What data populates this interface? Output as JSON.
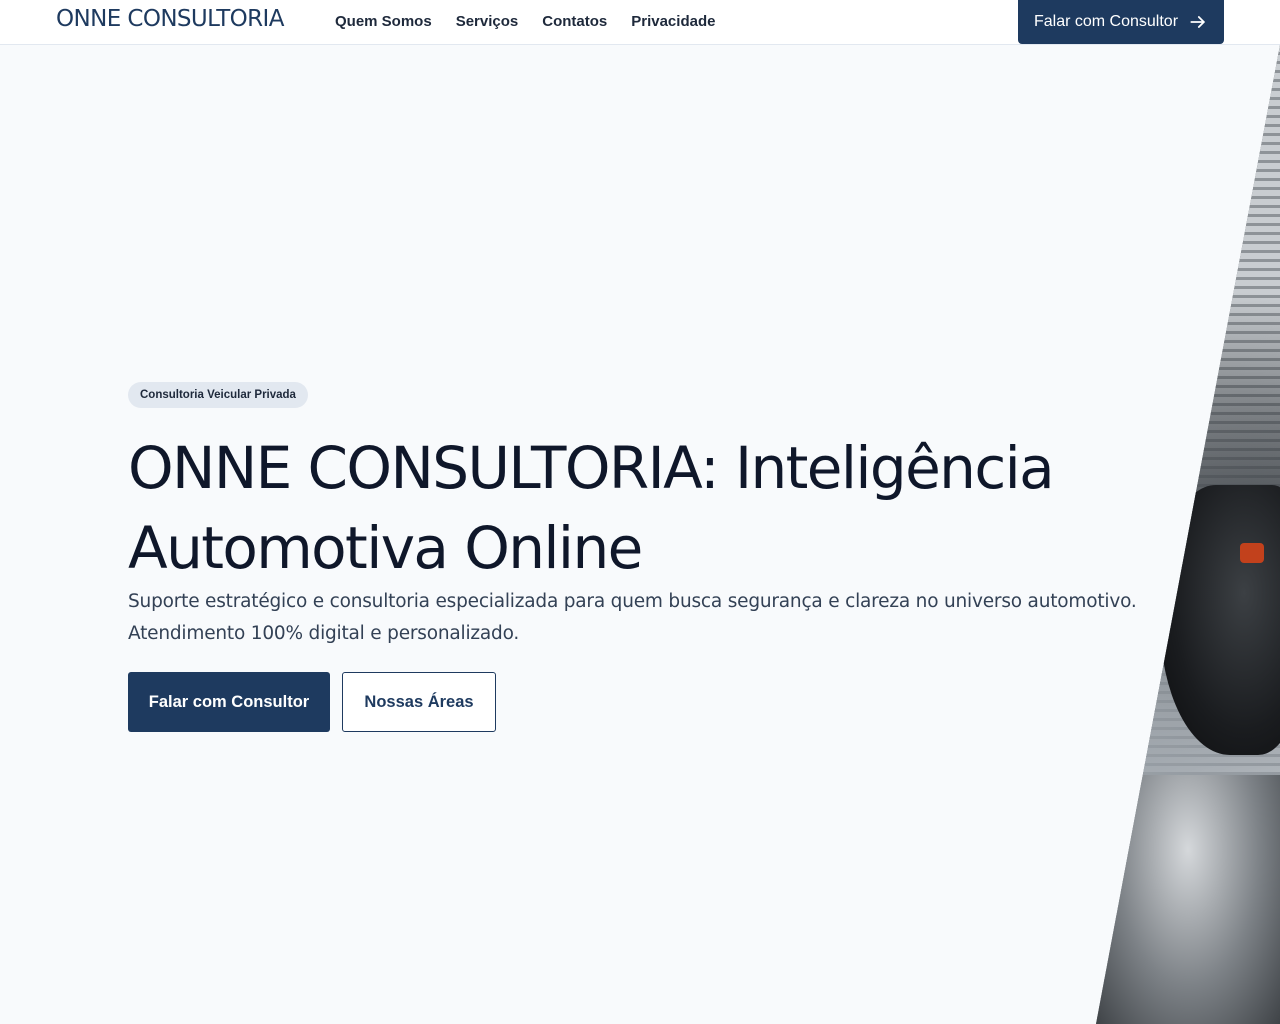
{
  "header": {
    "brand": "ONNE CONSULTORIA",
    "nav": [
      {
        "label": "Quem Somos"
      },
      {
        "label": "Serviços"
      },
      {
        "label": "Contatos"
      },
      {
        "label": "Privacidade"
      }
    ],
    "cta_label": "Falar com Consultor",
    "cta_icon": "arrow-right-icon"
  },
  "hero": {
    "badge": "Consultoria Veicular Privada",
    "headline": "ONNE CONSULTORIA: Inteligência Automotiva Online",
    "subtext": "Suporte estratégico e consultoria especializada para quem busca segurança e clareza no universo automotivo. Atendimento 100% digital e personalizado.",
    "primary_button": "Falar com Consultor",
    "secondary_button": "Nossas Áreas"
  },
  "colors": {
    "brand": "#1e3a5f",
    "background": "#f8fafc",
    "text": "#0f172a"
  }
}
